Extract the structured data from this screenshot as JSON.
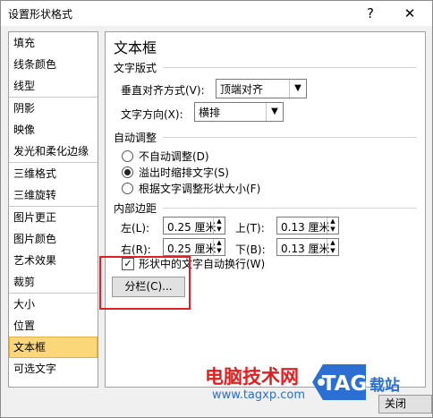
{
  "window": {
    "title": "设置形状格式",
    "help_label": "?",
    "close_label": "✕"
  },
  "sidebar": {
    "groups": [
      [
        "填充",
        "线条颜色",
        "线型"
      ],
      [
        "阴影",
        "映像",
        "发光和柔化边缘"
      ],
      [
        "三维格式",
        "三维旋转"
      ],
      [
        "图片更正",
        "图片颜色",
        "艺术效果",
        "裁剪"
      ],
      [
        "大小",
        "位置",
        "文本框",
        "可选文字"
      ]
    ],
    "active": "文本框"
  },
  "panel": {
    "title": "文本框",
    "text_layout": {
      "heading": "文字版式",
      "vertical_align_label": "垂直对齐方式(V):",
      "vertical_align_value": "顶端对齐",
      "direction_label": "文字方向(X):",
      "direction_value": "横排"
    },
    "autofit": {
      "heading": "自动调整",
      "options": [
        "不自动调整(D)",
        "溢出时缩排文字(S)",
        "根据文字调整形状大小(F)"
      ],
      "selected_index": 1
    },
    "margins": {
      "heading": "内部边距",
      "left_label": "左(L):",
      "left_value": "0.25 厘米",
      "top_label": "上(T):",
      "top_value": "0.13 厘米",
      "right_label": "右(R):",
      "right_value": "0.25 厘米",
      "bottom_label": "下(B):",
      "bottom_value": "0.13 厘米"
    },
    "wrap_label": "形状中的文字自动换行(W)",
    "wrap_checked": true,
    "columns_button": "分栏(C)..."
  },
  "footer": {
    "close_button": "关闭"
  },
  "watermark": {
    "cn": "电脑技术网",
    "url": "www.tagxp.com",
    "logo": "TAG",
    "site": "载站"
  },
  "colors": {
    "highlight": "#e02020",
    "active_item": "#fbd77a",
    "logo_blue": "#2a6fd1"
  }
}
